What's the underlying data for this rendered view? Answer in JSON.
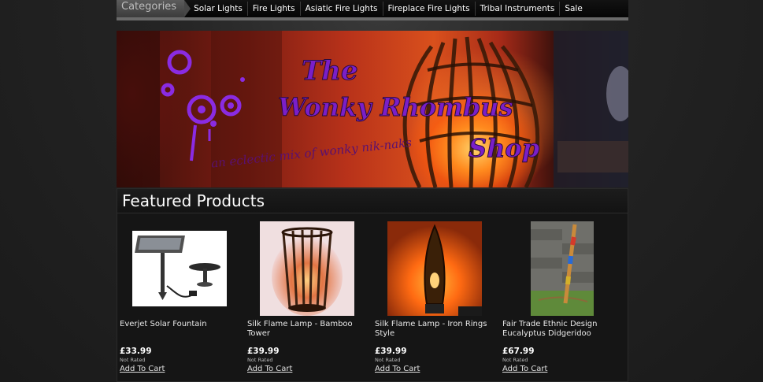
{
  "nav": {
    "categories_label": "Categories",
    "items": [
      "Solar Lights",
      "Fire Lights",
      "Asiatic Fire Lights",
      "Fireplace Fire Lights",
      "Tribal Instruments",
      "Sale"
    ]
  },
  "banner": {
    "line1": "The",
    "line2": "Wonky Rhombus",
    "line3": "Shop",
    "tagline": "an eclectic mix of wonky nik-naks"
  },
  "featured": {
    "title": "Featured Products",
    "products": [
      {
        "name": "Everjet Solar Fountain",
        "price": "£33.99",
        "rating": "Not Rated",
        "cta": "Add To Cart"
      },
      {
        "name": "Silk Flame Lamp - Bamboo Tower",
        "price": "£39.99",
        "rating": "Not Rated",
        "cta": "Add To Cart"
      },
      {
        "name": "Silk Flame Lamp - Iron Rings Style",
        "price": "£39.99",
        "rating": "Not Rated",
        "cta": "Add To Cart"
      },
      {
        "name": "Fair Trade Ethnic Design Eucalyptus Didgeridoo",
        "price": "£67.99",
        "rating": "Not Rated",
        "cta": "Add To Cart"
      }
    ]
  }
}
